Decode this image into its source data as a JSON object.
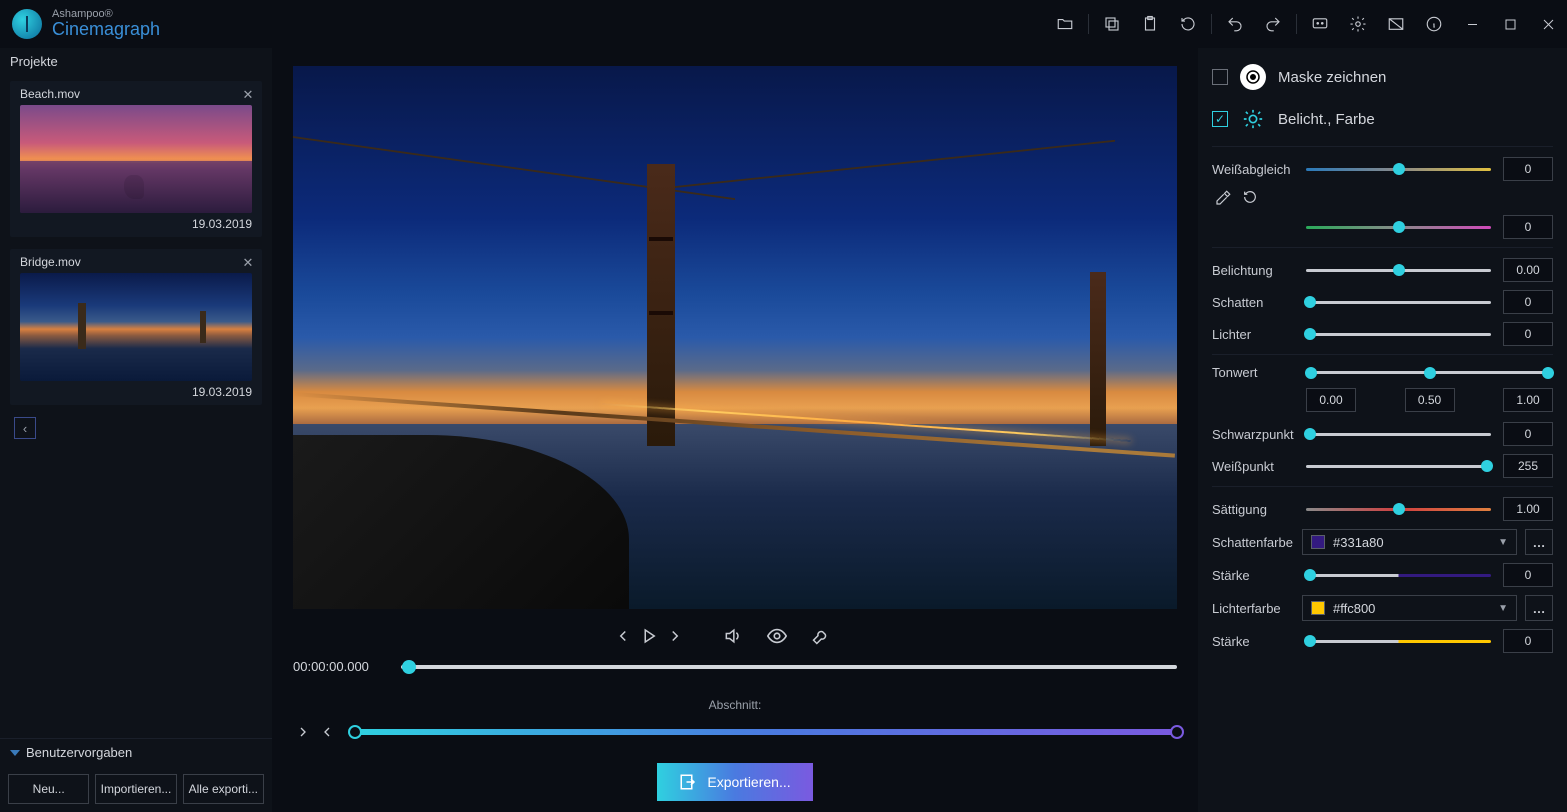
{
  "brand": {
    "top": "Ashampoo®",
    "bottom": "Cinemagraph"
  },
  "sidebar": {
    "header": "Projekte",
    "projects": [
      {
        "name": "Beach.mov",
        "date": "19.03.2019"
      },
      {
        "name": "Bridge.mov",
        "date": "19.03.2019"
      }
    ],
    "presets_label": "Benutzervorgaben",
    "buttons": {
      "new": "Neu...",
      "import": "Importieren...",
      "export_all": "Alle exporti..."
    }
  },
  "transport": {
    "time": "00:00:00.000",
    "section_label": "Abschnitt:"
  },
  "footer": {
    "export": "Exportieren..."
  },
  "panel": {
    "mask": {
      "title": "Maske zeichnen",
      "checked": false
    },
    "expo": {
      "title": "Belicht., Farbe",
      "checked": true
    },
    "wb": {
      "label": "Weißabgleich",
      "v1": "0",
      "v2": "0"
    },
    "exposure": {
      "label": "Belichtung",
      "v": "0.00"
    },
    "shadows": {
      "label": "Schatten",
      "v": "0"
    },
    "highlights": {
      "label": "Lichter",
      "v": "0"
    },
    "tone": {
      "label": "Tonwert",
      "v0": "0.00",
      "v1": "0.50",
      "v2": "1.00"
    },
    "black": {
      "label": "Schwarzpunkt",
      "v": "0"
    },
    "white": {
      "label": "Weißpunkt",
      "v": "255"
    },
    "sat": {
      "label": "Sättigung",
      "v": "1.00"
    },
    "shcolor": {
      "label": "Schattenfarbe",
      "hex": "#331a80"
    },
    "shstr": {
      "label": "Stärke",
      "v": "0"
    },
    "hlcolor": {
      "label": "Lichterfarbe",
      "hex": "#ffc800"
    },
    "hlstr": {
      "label": "Stärke",
      "v": "0"
    }
  }
}
